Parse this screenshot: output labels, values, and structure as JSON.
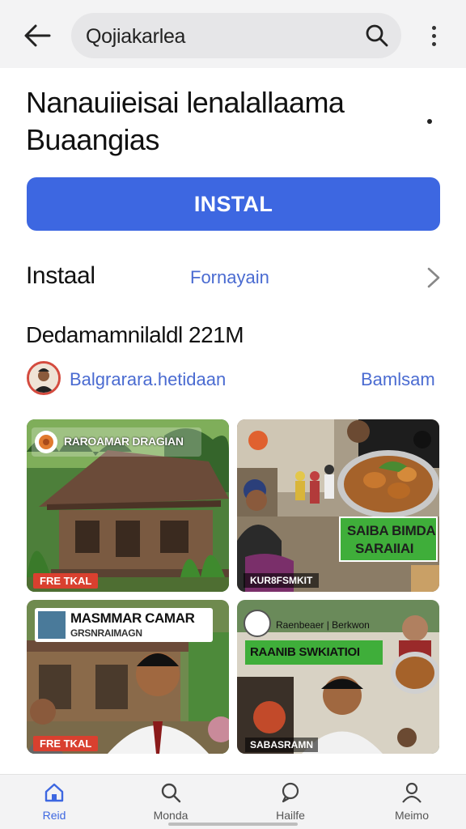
{
  "header": {
    "search_text": "Qojiakarlea"
  },
  "app": {
    "title_line1": "Nanauiieisai lenalallaama",
    "title_line2": "Buaangias",
    "install_button": "INSTAL",
    "install_label": "Instaal",
    "install_sub": "Fornayain",
    "downloads": "Dedamamnilaldl 221M",
    "developer_name": "Balgrarara.hetidaan",
    "developer_link": "Bamlsam"
  },
  "thumbnails": [
    {
      "title": "RAROAMAR DRAGIAN",
      "badge": "FRE TKAL"
    },
    {
      "banner_line1": "SAIBA BIMDA",
      "banner_line2": "SARAIIAI",
      "caption": "KUR8FSMKIT"
    },
    {
      "title_line1": "MASMMAR CAMAR",
      "title_line2": "GRSNRAIMAGN",
      "badge": "FRE TKAL"
    },
    {
      "header": "Raenbeaer | Berkwon",
      "banner": "RAANIB SWKIATIOI",
      "caption": "SABASRAMN"
    }
  ],
  "nav": {
    "items": [
      {
        "label": "Reid",
        "icon": "home-icon",
        "active": true
      },
      {
        "label": "Monda",
        "icon": "search-icon",
        "active": false
      },
      {
        "label": "Hailfe",
        "icon": "chat-bubble-icon",
        "active": false
      },
      {
        "label": "Meimo",
        "icon": "person-icon",
        "active": false
      }
    ]
  },
  "colors": {
    "accent": "#3d67e1",
    "link": "#4a6bd1",
    "badge_red": "#d9402f",
    "banner_green": "#3fae3a"
  }
}
